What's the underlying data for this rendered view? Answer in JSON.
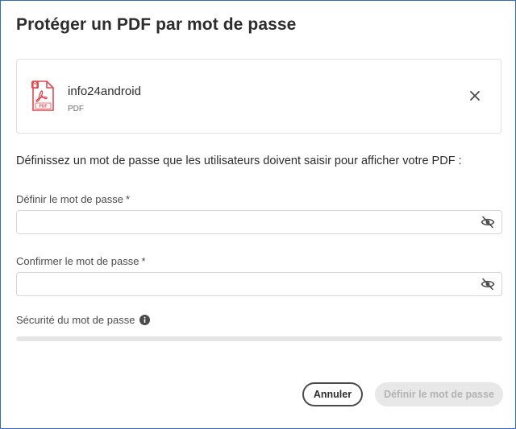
{
  "dialog": {
    "title": "Protéger un PDF par mot de passe"
  },
  "file": {
    "name": "info24android",
    "type": "PDF",
    "icon": "pdf-file-icon",
    "icon_color": "#e34850"
  },
  "instruction": "Définissez un mot de passe que les utilisateurs doivent saisir pour afficher votre PDF :",
  "fields": {
    "set_password": {
      "label": "Définir le mot de passe",
      "required_mark": "*",
      "value": ""
    },
    "confirm_password": {
      "label": "Confirmer le mot de passe",
      "required_mark": "*",
      "value": ""
    }
  },
  "strength": {
    "label": "Sécurité du mot de passe",
    "level": 0
  },
  "buttons": {
    "cancel": "Annuler",
    "set_password": "Définir le mot de passe"
  },
  "colors": {
    "window_border": "#2f6fb5",
    "disabled_button_bg": "#e8e8e8",
    "disabled_button_text": "#b3b3b3"
  }
}
